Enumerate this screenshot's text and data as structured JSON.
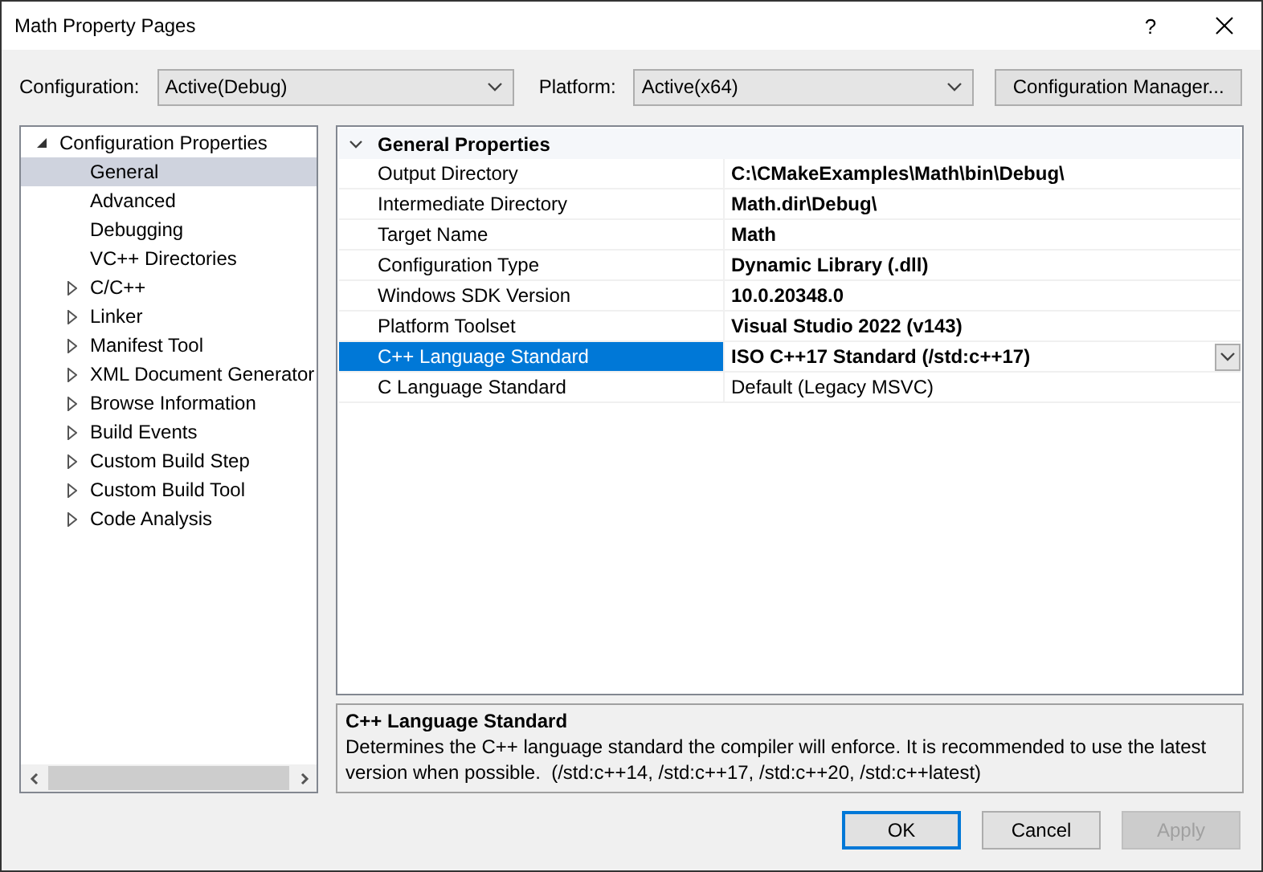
{
  "window": {
    "title": "Math Property Pages",
    "help": "?"
  },
  "configuration": {
    "label": "Configuration:",
    "value": "Active(Debug)"
  },
  "platform": {
    "label": "Platform:",
    "value": "Active(x64)"
  },
  "configuration_manager": "Configuration Manager...",
  "tree": [
    {
      "label": "Configuration Properties",
      "kind": "group",
      "expanded": true,
      "selected": false,
      "children": [
        {
          "label": "General",
          "kind": "leaf",
          "selected": true
        },
        {
          "label": "Advanced",
          "kind": "leaf",
          "selected": false
        },
        {
          "label": "Debugging",
          "kind": "leaf",
          "selected": false
        },
        {
          "label": "VC++ Directories",
          "kind": "leaf",
          "selected": false
        },
        {
          "label": "C/C++",
          "kind": "group",
          "expanded": false,
          "selected": false
        },
        {
          "label": "Linker",
          "kind": "group",
          "expanded": false,
          "selected": false
        },
        {
          "label": "Manifest Tool",
          "kind": "group",
          "expanded": false,
          "selected": false
        },
        {
          "label": "XML Document Generator",
          "kind": "group",
          "expanded": false,
          "selected": false
        },
        {
          "label": "Browse Information",
          "kind": "group",
          "expanded": false,
          "selected": false
        },
        {
          "label": "Build Events",
          "kind": "group",
          "expanded": false,
          "selected": false
        },
        {
          "label": "Custom Build Step",
          "kind": "group",
          "expanded": false,
          "selected": false
        },
        {
          "label": "Custom Build Tool",
          "kind": "group",
          "expanded": false,
          "selected": false
        },
        {
          "label": "Code Analysis",
          "kind": "group",
          "expanded": false,
          "selected": false
        }
      ]
    }
  ],
  "properties": {
    "section": "General Properties",
    "expanded": true,
    "rows": [
      {
        "name": "Output Directory",
        "value": "C:\\CMakeExamples\\Math\\bin\\Debug\\",
        "bold": true,
        "selected": false
      },
      {
        "name": "Intermediate Directory",
        "value": "Math.dir\\Debug\\",
        "bold": true,
        "selected": false
      },
      {
        "name": "Target Name",
        "value": "Math",
        "bold": true,
        "selected": false
      },
      {
        "name": "Configuration Type",
        "value": "Dynamic Library (.dll)",
        "bold": true,
        "selected": false
      },
      {
        "name": "Windows SDK Version",
        "value": "10.0.20348.0",
        "bold": true,
        "selected": false
      },
      {
        "name": "Platform Toolset",
        "value": "Visual Studio 2022 (v143)",
        "bold": true,
        "selected": false
      },
      {
        "name": "C++ Language Standard",
        "value": "ISO C++17 Standard (/std:c++17)",
        "bold": true,
        "selected": true
      },
      {
        "name": "C Language Standard",
        "value": "Default (Legacy MSVC)",
        "bold": false,
        "selected": false
      }
    ]
  },
  "description": {
    "title": "C++ Language Standard",
    "text": "Determines the C++ language standard the compiler will enforce. It is recommended to use the latest version when possible.  (/std:c++14, /std:c++17, /std:c++20, /std:c++latest)"
  },
  "buttons": [
    {
      "label": "OK",
      "default": true,
      "disabled": false
    },
    {
      "label": "Cancel",
      "default": false,
      "disabled": false
    },
    {
      "label": "Apply",
      "default": false,
      "disabled": true
    }
  ]
}
